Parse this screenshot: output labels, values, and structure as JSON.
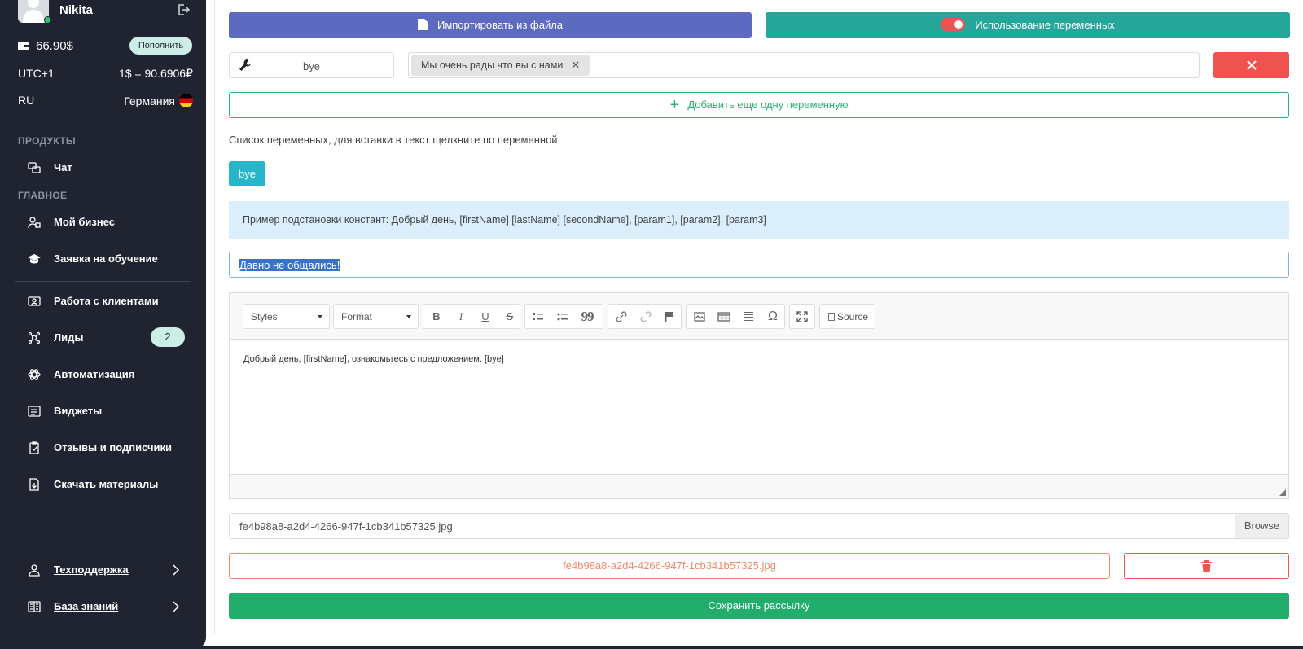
{
  "sidebar": {
    "user_name": "Nikita",
    "balance": "66.90$",
    "topup_label": "Пополнить",
    "timezone": "UTC+1",
    "exchange_rate": "1$ = 90.6906₽",
    "language": "RU",
    "country": "Германия",
    "section_products": "ПРОДУКТЫ",
    "section_main": "ГЛАВНОЕ",
    "items": [
      {
        "label": "Чат",
        "icon": "chat-icon"
      },
      {
        "label": "Мой бизнес",
        "icon": "business-icon"
      },
      {
        "label": "Заявка на обучение",
        "icon": "graduation-cap-icon"
      },
      {
        "label": "Работа с клиентами",
        "icon": "client-card-icon"
      },
      {
        "label": "Лиды",
        "icon": "leads-icon",
        "badge": "2"
      },
      {
        "label": "Автоматизация",
        "icon": "automation-icon"
      },
      {
        "label": "Виджеты",
        "icon": "widgets-icon"
      },
      {
        "label": "Отзывы и подписчики",
        "icon": "reviews-icon"
      },
      {
        "label": "Скачать материалы",
        "icon": "download-doc-icon"
      }
    ],
    "support_label": "Техподдержка",
    "knowledge_label": "База знаний"
  },
  "main": {
    "import_label": "Импортировать из файла",
    "use_vars_label": "Использование переменных",
    "var_key_value": "bye",
    "var_value_chip": "Мы очень рады что вы с нами",
    "add_var_label": "Добавить еще одну переменную",
    "vars_hint": "Список переменных, для вставки в текст щелкните по переменной",
    "var_tag": "bye",
    "constants_example": "Пример подстановки констант: Добрый день, [firstName] [lastName] [secondName], [param1], [param2], [param3]",
    "subject_value": "Давно не общались!",
    "editor": {
      "styles_label": "Styles",
      "format_label": "Format",
      "bold": "B",
      "italic": "I",
      "underline": "U",
      "strike": "S",
      "quote": "99",
      "omega": "Ω",
      "source_label": "Source",
      "body_text": "Добрый день, [firstName], ознакомьтесь с предложением. [bye]"
    },
    "file_input_value": "fe4b98a8-a2d4-4266-947f-1cb341b57325.jpg",
    "browse_label": "Browse",
    "attached_file": "fe4b98a8-a2d4-4266-947f-1cb341b57325.jpg",
    "save_label": "Сохранить рассылку"
  },
  "colors": {
    "sidebar_bg": "#1f2430",
    "import_btn": "#5c6bc0",
    "vars_btn": "#26a69a",
    "danger": "#ef5350",
    "success": "#21ad6b",
    "info_bg": "#dbeefc",
    "var_tag": "#26b5c9"
  }
}
